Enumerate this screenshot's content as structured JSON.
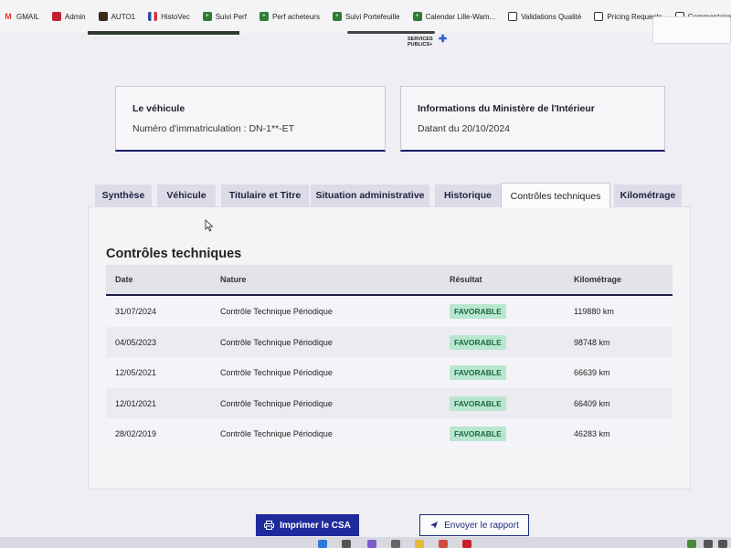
{
  "bookmarks": [
    {
      "label": "GMAIL",
      "icon": "gmail-icon"
    },
    {
      "label": "Admin",
      "icon": "admin-icon"
    },
    {
      "label": "AUTO1",
      "icon": "auto1-icon"
    },
    {
      "label": "HistoVec",
      "icon": "histovec-flag-icon"
    },
    {
      "label": "Suivi Perf",
      "icon": "sheet-icon"
    },
    {
      "label": "Perf acheteurs",
      "icon": "sheet-icon"
    },
    {
      "label": "Suivi Portefeuille",
      "icon": "sheet-icon"
    },
    {
      "label": "Calendar Lille-Wam...",
      "icon": "sheet-icon"
    },
    {
      "label": "Validations Qualité",
      "icon": "page-icon"
    },
    {
      "label": "Pricing Requests",
      "icon": "page-icon"
    },
    {
      "label": "Commentaire VH S",
      "icon": "page-icon"
    }
  ],
  "logo": {
    "line1": "SERVICES",
    "line2": "PUBLICS+"
  },
  "vehicle_box": {
    "title": "Le véhicule",
    "line": "Numéro d'immatriculation : DN-1**-ET"
  },
  "ministry_box": {
    "title": "Informations du Ministère de l'Intérieur",
    "line": "Datant du 20/10/2024"
  },
  "tabs": [
    {
      "label": "Synthèse",
      "active": false
    },
    {
      "label": "Véhicule",
      "active": false
    },
    {
      "label": "Titulaire et Titre",
      "active": false
    },
    {
      "label": "Situation administrative",
      "active": false
    },
    {
      "label": "Historique",
      "active": false
    },
    {
      "label": "Contrôles techniques",
      "active": true
    },
    {
      "label": "Kilométrage",
      "active": false
    }
  ],
  "section": {
    "title": "Contrôles techniques"
  },
  "table": {
    "headers": {
      "date": "Date",
      "nature": "Nature",
      "result": "Résultat",
      "mileage": "Kilométrage"
    },
    "rows": [
      {
        "date": "31/07/2024",
        "nature": "Contrôle Technique Périodique",
        "result": "FAVORABLE",
        "mileage": "119880 km"
      },
      {
        "date": "04/05/2023",
        "nature": "Contrôle Technique Périodique",
        "result": "FAVORABLE",
        "mileage": "98748 km"
      },
      {
        "date": "12/05/2021",
        "nature": "Contrôle Technique Périodique",
        "result": "FAVORABLE",
        "mileage": "66639 km"
      },
      {
        "date": "12/01/2021",
        "nature": "Contrôle Technique Périodique",
        "result": "FAVORABLE",
        "mileage": "66409 km"
      },
      {
        "date": "28/02/2019",
        "nature": "Contrôle Technique Périodique",
        "result": "FAVORABLE",
        "mileage": "46283 km"
      }
    ]
  },
  "actions": {
    "print_label": "Imprimer le CSA",
    "send_label": "Envoyer le rapport"
  },
  "colors": {
    "primary": "#1f2a9c",
    "badge_bg": "#b8e6cf",
    "badge_text": "#1c6a44"
  }
}
